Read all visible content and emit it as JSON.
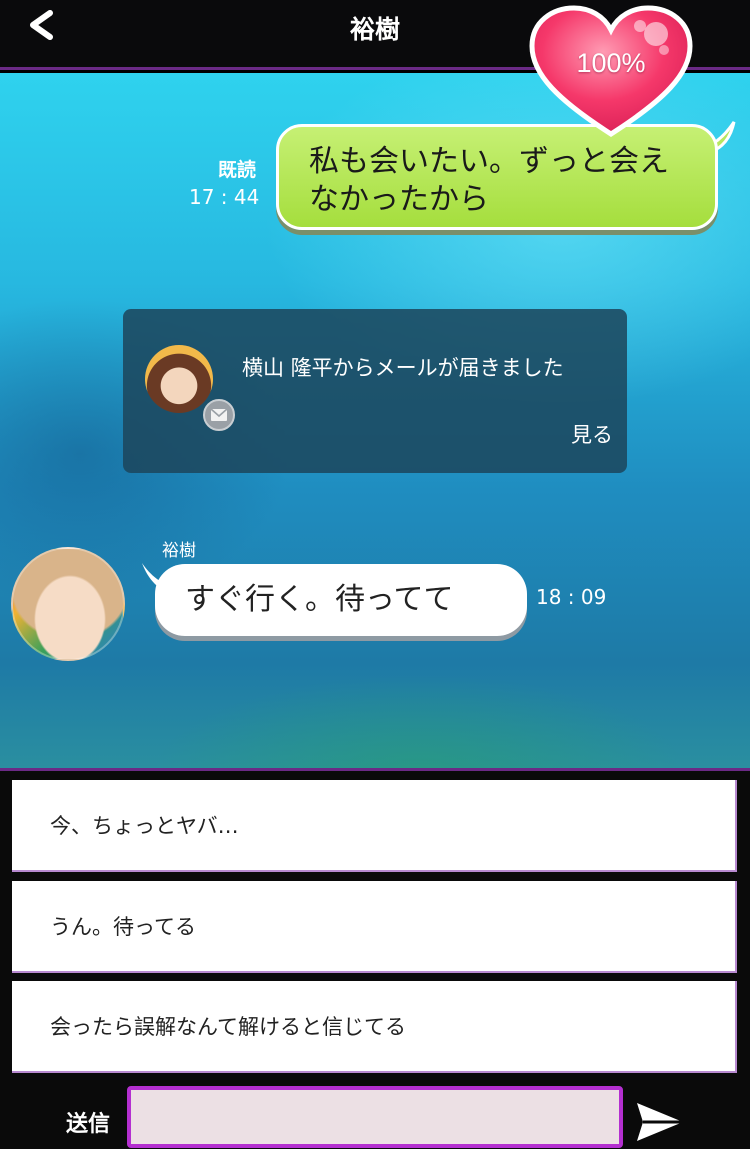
{
  "header": {
    "back_icon": "chevron-left-icon",
    "title": "裕樹"
  },
  "affection": {
    "label": "100%",
    "value_percent": 100,
    "icon": "heart-icon",
    "color": "#f5386a"
  },
  "messages": [
    {
      "side": "right",
      "read_label": "既読",
      "time": "17 : 44",
      "text_line1": "私も会いたい。ずっと会え",
      "text_line2": "なかったから",
      "bubble_color": "#b2e655"
    },
    {
      "side": "left",
      "sender": "裕樹",
      "text": "すぐ行く。待ってて",
      "time": "18 : 09"
    }
  ],
  "notification": {
    "text": "横山 隆平からメールが届きました",
    "action": "見る",
    "icon": "mail-icon"
  },
  "options": [
    "今、ちょっとヤバ…",
    "うん。待ってる",
    "会ったら誤解なんて解けると信じてる"
  ],
  "input": {
    "send_label": "送信",
    "placeholder": "",
    "send_icon": "paper-plane-icon",
    "border_color": "#b42fd0"
  }
}
